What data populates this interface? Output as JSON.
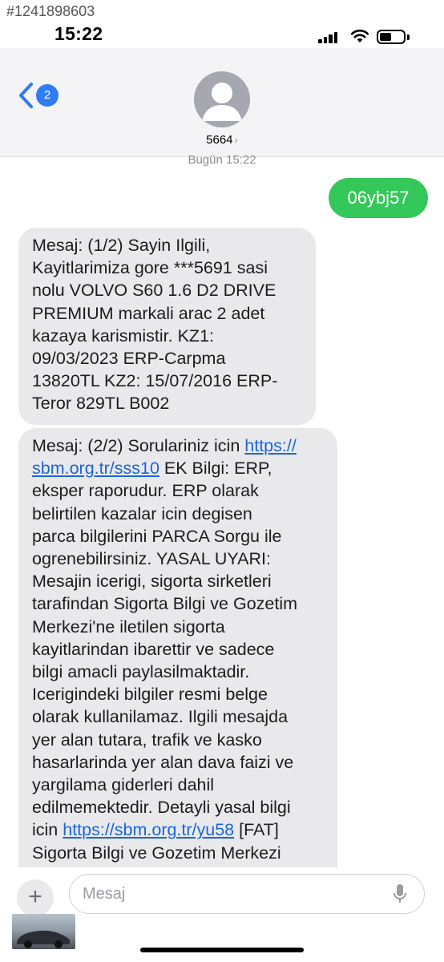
{
  "listing_id": "#1241898603",
  "status_bar": {
    "time": "15:22"
  },
  "header": {
    "back_badge_count": "2",
    "contact_name": "5664",
    "contact_chevron": "›"
  },
  "conversation": {
    "timestamp": "Bugün 15:22",
    "sent_message": "06ybj57",
    "message1_lines": [
      "Mesaj: (1/2) Sayin Ilgili,",
      "Kayitlarimiza gore ***5691 sasi",
      "nolu VOLVO S60 1.6 D2 DRIVE",
      "PREMIUM markali arac 2 adet",
      "kazaya karismistir. KZ1:",
      "09/03/2023 ERP-Carpma",
      "13820TL KZ2: 15/07/2016 ERP-",
      "Teror 829TL B002"
    ],
    "message2": {
      "l1_text": "Mesaj: (2/2) Sorulariniz icin ",
      "l1_link": "https://",
      "l2_link": "sbm.org.tr/sss10",
      "l2_text": " EK Bilgi: ERP,",
      "lines_mid": [
        "eksper raporudur. ERP olarak",
        "belirtilen kazalar icin degisen",
        "parca bilgilerini PARCA Sorgu ile",
        "ogrenebilirsiniz. YASAL UYARI:",
        "Mesajin icerigi, sigorta sirketleri",
        "tarafindan Sigorta Bilgi ve Gozetim",
        "Merkezi'ne iletilen sigorta",
        "kayitlarindan ibarettir ve sadece",
        "bilgi amacli paylasilmaktadir.",
        "Icerigindeki bilgiler resmi belge",
        "olarak kullanilamaz. Ilgili mesajda",
        "yer alan tutara, trafik ve kasko",
        "hasarlarinda yer alan dava faizi ve",
        "yargilama giderleri dahil",
        "edilmemektedir. Detayli yasal bilgi"
      ],
      "l_last_text": "icin ",
      "l_last_link": "https://sbm.org.tr/yu58",
      "l_last_after": " [FAT]",
      "l_final": "Sigorta Bilgi ve Gozetim Merkezi"
    }
  },
  "input": {
    "plus_label": "+",
    "placeholder": "Mesaj"
  },
  "colors": {
    "sent_bubble": "#34c759",
    "received_bubble": "#e9e9eb",
    "link": "#1a66d8",
    "badge": "#2f7cf6"
  },
  "icons": [
    "back-chevron-icon",
    "person-avatar-icon",
    "signal-icon",
    "wifi-icon",
    "battery-icon",
    "plus-icon",
    "microphone-icon"
  ]
}
